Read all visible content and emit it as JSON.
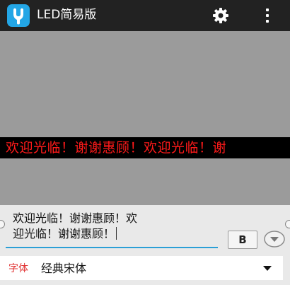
{
  "app": {
    "title": "LED简易版",
    "icons": {
      "app_icon": "app-logo-icon",
      "settings": "gear-icon",
      "menu": "overflow-menu-icon"
    }
  },
  "preview": {
    "led_text": "欢迎光临！谢谢惠顾！欢迎光临！谢",
    "colors": {
      "text": "#ff1a1a",
      "strip": "#000000",
      "background": "#9b9b9b"
    }
  },
  "editor": {
    "text_line1": "欢迎光临！谢谢惠顾！欢",
    "text_line2": "迎光临！谢谢惠顾！",
    "bold_label": "B",
    "accent": "#2b9fd6"
  },
  "font": {
    "label": "字体",
    "selected": "经典宋体"
  }
}
